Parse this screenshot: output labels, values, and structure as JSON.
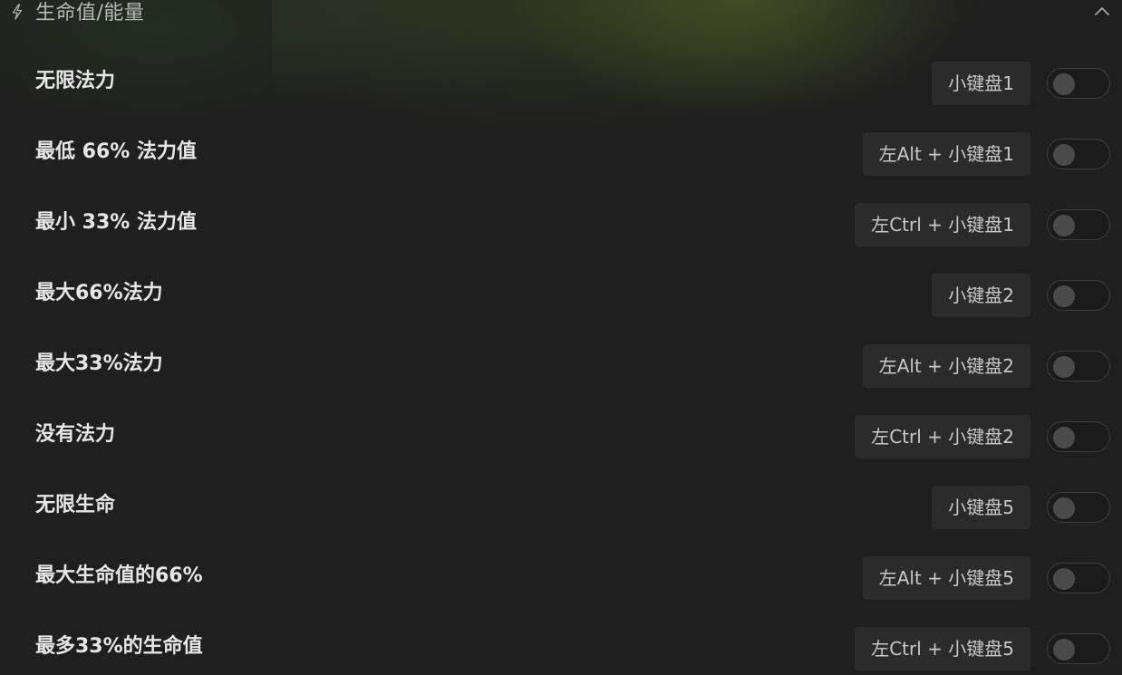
{
  "section": {
    "title": "生命值/能量",
    "icon": "lightning-bolt-icon",
    "collapse_icon": "chevron-up-icon",
    "expanded": true
  },
  "rows": [
    {
      "label": "无限法力",
      "hotkey": "小键盘1",
      "enabled": false
    },
    {
      "label": "最低 66% 法力值",
      "hotkey": "左Alt + 小键盘1",
      "enabled": false
    },
    {
      "label": "最小 33% 法力值",
      "hotkey": "左Ctrl + 小键盘1",
      "enabled": false
    },
    {
      "label": "最大66%法力",
      "hotkey": "小键盘2",
      "enabled": false
    },
    {
      "label": "最大33%法力",
      "hotkey": "左Alt + 小键盘2",
      "enabled": false
    },
    {
      "label": "没有法力",
      "hotkey": "左Ctrl + 小键盘2",
      "enabled": false
    },
    {
      "label": "无限生命",
      "hotkey": "小键盘5",
      "enabled": false
    },
    {
      "label": "最大生命值的66%",
      "hotkey": "左Alt + 小键盘5",
      "enabled": false
    },
    {
      "label": "最多33%的生命值",
      "hotkey": "左Ctrl + 小键盘5",
      "enabled": false
    }
  ],
  "colors": {
    "background": "#1f1f1f",
    "hotkey_bg": "#2b2b2b",
    "toggle_off_knob": "#4a4a4a",
    "label_text": "#e6e6e6"
  }
}
